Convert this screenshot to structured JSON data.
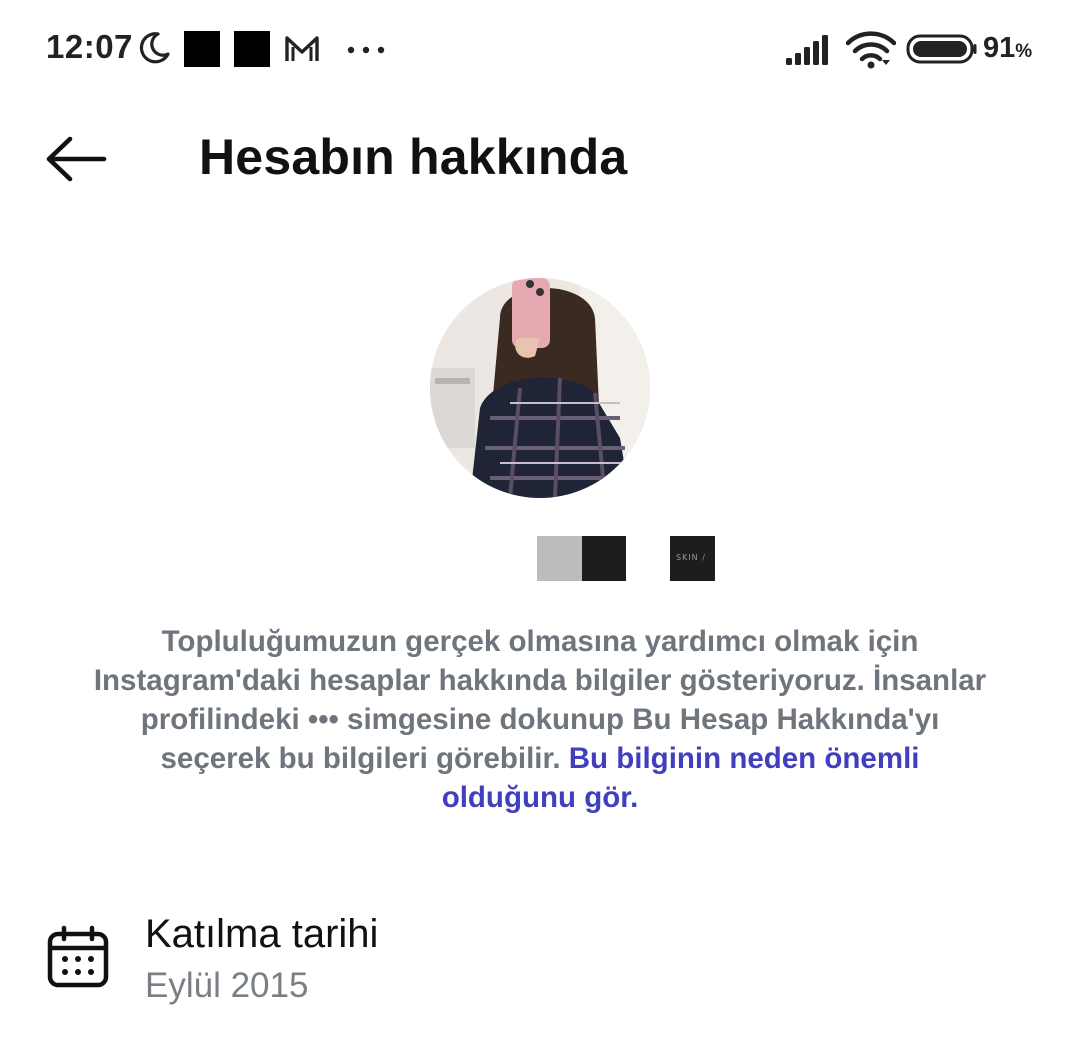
{
  "status_bar": {
    "time": "12:07",
    "battery_percent": "91",
    "battery_unit": "%",
    "icons": [
      "moon-icon",
      "mail-icon",
      "more-dots-icon",
      "signal-icon",
      "wifi-icon",
      "battery-icon"
    ]
  },
  "header": {
    "title": "Hesabın hakkında",
    "back_icon": "arrow-left-icon"
  },
  "info": {
    "text": "Topluluğumuzun gerçek olmasına yardımcı olmak için Instagram'daki hesaplar hakkında bilgiler gösteriyoruz. İnsanlar profilindeki ••• simgesine dokunup Bu Hesap Hakkında'yı seçerek bu bilgileri görebilir. ",
    "link": "Bu bilginin neden önemli olduğunu gör."
  },
  "joined": {
    "icon": "calendar-icon",
    "label": "Katılma tarihi",
    "value": "Eylül 2015"
  },
  "colors": {
    "info_text": "#6e757c",
    "link": "#3f3fbf",
    "secondary_text": "#7a7f85"
  }
}
